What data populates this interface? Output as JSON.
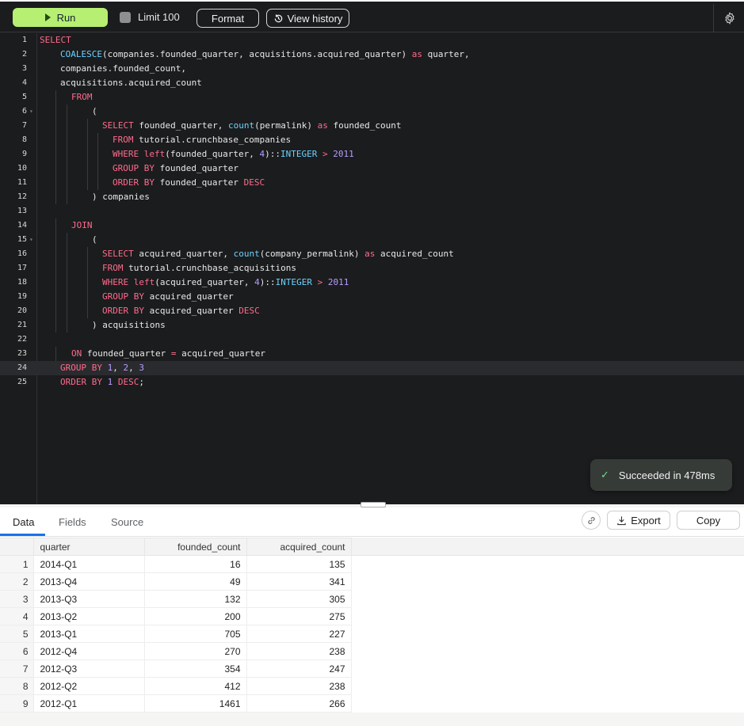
{
  "toolbar": {
    "run_label": "Run",
    "limit_label": "Limit 100",
    "format_label": "Format",
    "history_label": "View history",
    "settings_icon": "gear-icon"
  },
  "editor": {
    "active_line": 24,
    "lines": [
      {
        "n": "1",
        "fold": false,
        "indent": 0,
        "parts": [
          [
            "k",
            "SELECT"
          ]
        ]
      },
      {
        "n": "2",
        "fold": false,
        "indent": 1,
        "parts": [
          [
            "f",
            "COALESCE"
          ],
          [
            "s",
            "(companies.founded_quarter, acquisitions.acquired_quarter) "
          ],
          [
            "k",
            "as"
          ],
          [
            "s",
            " quarter,"
          ]
        ]
      },
      {
        "n": "3",
        "fold": false,
        "indent": 1,
        "parts": [
          [
            "s",
            "companies.founded_count,"
          ]
        ]
      },
      {
        "n": "4",
        "fold": false,
        "indent": 1,
        "parts": [
          [
            "s",
            "acquisitions.acquired_count"
          ]
        ]
      },
      {
        "n": "5",
        "fold": false,
        "indent": 2,
        "parts": [
          [
            "k",
            "FROM"
          ]
        ]
      },
      {
        "n": "6",
        "fold": true,
        "indent": 3,
        "parts": [
          [
            "s",
            "("
          ]
        ]
      },
      {
        "n": "7",
        "fold": false,
        "indent": 4,
        "parts": [
          [
            "k",
            "SELECT"
          ],
          [
            "s",
            " founded_quarter, "
          ],
          [
            "f",
            "count"
          ],
          [
            "s",
            "(permalink) "
          ],
          [
            "k",
            "as"
          ],
          [
            "s",
            " founded_count"
          ]
        ]
      },
      {
        "n": "8",
        "fold": false,
        "indent": 5,
        "parts": [
          [
            "k",
            "FROM"
          ],
          [
            "s",
            " tutorial.crunchbase_companies"
          ]
        ]
      },
      {
        "n": "9",
        "fold": false,
        "indent": 5,
        "parts": [
          [
            "k",
            "WHERE"
          ],
          [
            "s",
            " "
          ],
          [
            "k",
            "left"
          ],
          [
            "s",
            "(founded_quarter, "
          ],
          [
            "n",
            "4"
          ],
          [
            "s",
            ")::"
          ],
          [
            "f",
            "INTEGER"
          ],
          [
            "s",
            " "
          ],
          [
            "k",
            ">"
          ],
          [
            "s",
            " "
          ],
          [
            "n",
            "2011"
          ]
        ]
      },
      {
        "n": "10",
        "fold": false,
        "indent": 5,
        "parts": [
          [
            "k",
            "GROUP BY"
          ],
          [
            "s",
            " founded_quarter"
          ]
        ]
      },
      {
        "n": "11",
        "fold": false,
        "indent": 5,
        "parts": [
          [
            "k",
            "ORDER BY"
          ],
          [
            "s",
            " founded_quarter "
          ],
          [
            "k",
            "DESC"
          ]
        ]
      },
      {
        "n": "12",
        "fold": false,
        "indent": 3,
        "parts": [
          [
            "s",
            ") companies"
          ]
        ]
      },
      {
        "n": "13",
        "fold": false,
        "indent": 0,
        "parts": []
      },
      {
        "n": "14",
        "fold": false,
        "indent": 2,
        "parts": [
          [
            "k",
            "JOIN"
          ]
        ]
      },
      {
        "n": "15",
        "fold": true,
        "indent": 3,
        "parts": [
          [
            "s",
            "("
          ]
        ]
      },
      {
        "n": "16",
        "fold": false,
        "indent": 4,
        "parts": [
          [
            "k",
            "SELECT"
          ],
          [
            "s",
            " acquired_quarter, "
          ],
          [
            "f",
            "count"
          ],
          [
            "s",
            "(company_permalink) "
          ],
          [
            "k",
            "as"
          ],
          [
            "s",
            " acquired_count"
          ]
        ]
      },
      {
        "n": "17",
        "fold": false,
        "indent": 4,
        "parts": [
          [
            "k",
            "FROM"
          ],
          [
            "s",
            " tutorial.crunchbase_acquisitions"
          ]
        ]
      },
      {
        "n": "18",
        "fold": false,
        "indent": 4,
        "parts": [
          [
            "k",
            "WHERE"
          ],
          [
            "s",
            " "
          ],
          [
            "k",
            "left"
          ],
          [
            "s",
            "(acquired_quarter, "
          ],
          [
            "n",
            "4"
          ],
          [
            "s",
            ")::"
          ],
          [
            "f",
            "INTEGER"
          ],
          [
            "s",
            " "
          ],
          [
            "k",
            ">"
          ],
          [
            "s",
            " "
          ],
          [
            "n",
            "2011"
          ]
        ]
      },
      {
        "n": "19",
        "fold": false,
        "indent": 4,
        "parts": [
          [
            "k",
            "GROUP BY"
          ],
          [
            "s",
            " acquired_quarter"
          ]
        ]
      },
      {
        "n": "20",
        "fold": false,
        "indent": 4,
        "parts": [
          [
            "k",
            "ORDER BY"
          ],
          [
            "s",
            " acquired_quarter "
          ],
          [
            "k",
            "DESC"
          ]
        ]
      },
      {
        "n": "21",
        "fold": false,
        "indent": 3,
        "parts": [
          [
            "s",
            ") acquisitions"
          ]
        ]
      },
      {
        "n": "22",
        "fold": false,
        "indent": 0,
        "parts": []
      },
      {
        "n": "23",
        "fold": false,
        "indent": 2,
        "parts": [
          [
            "k",
            "ON"
          ],
          [
            "s",
            " founded_quarter "
          ],
          [
            "k",
            "="
          ],
          [
            "s",
            " acquired_quarter"
          ]
        ]
      },
      {
        "n": "24",
        "fold": false,
        "indent": 1,
        "parts": [
          [
            "k",
            "GROUP BY"
          ],
          [
            "s",
            " "
          ],
          [
            "n",
            "1"
          ],
          [
            "s",
            ", "
          ],
          [
            "n",
            "2"
          ],
          [
            "s",
            ", "
          ],
          [
            "n",
            "3"
          ]
        ]
      },
      {
        "n": "25",
        "fold": false,
        "indent": 1,
        "parts": [
          [
            "k",
            "ORDER BY"
          ],
          [
            "s",
            " "
          ],
          [
            "n",
            "1"
          ],
          [
            "s",
            " "
          ],
          [
            "k",
            "DESC"
          ],
          [
            "s",
            ";"
          ]
        ]
      }
    ]
  },
  "toast": {
    "message": "Succeeded in 478ms"
  },
  "results": {
    "tabs": [
      "Data",
      "Fields",
      "Source"
    ],
    "active_tab": "Data",
    "link_icon": "link-icon",
    "export_label": "Export",
    "copy_label": "Copy",
    "columns": [
      "quarter",
      "founded_count",
      "acquired_count"
    ],
    "rows": [
      [
        "1",
        "2014-Q1",
        "16",
        "135"
      ],
      [
        "2",
        "2013-Q4",
        "49",
        "341"
      ],
      [
        "3",
        "2013-Q3",
        "132",
        "305"
      ],
      [
        "4",
        "2013-Q2",
        "200",
        "275"
      ],
      [
        "5",
        "2013-Q1",
        "705",
        "227"
      ],
      [
        "6",
        "2012-Q4",
        "270",
        "238"
      ],
      [
        "7",
        "2012-Q3",
        "354",
        "247"
      ],
      [
        "8",
        "2012-Q2",
        "412",
        "238"
      ],
      [
        "9",
        "2012-Q1",
        "1461",
        "266"
      ]
    ]
  }
}
